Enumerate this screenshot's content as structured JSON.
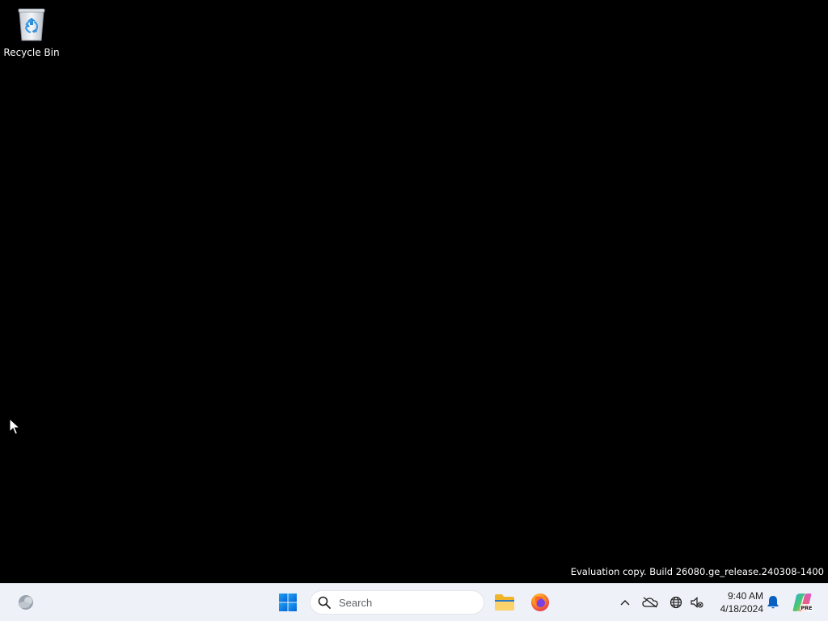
{
  "desktop": {
    "icons": [
      {
        "label": "Recycle Bin",
        "icon": "recycle-bin-icon"
      }
    ],
    "watermark": "Evaluation copy. Build 26080.ge_release.240308-1400",
    "background": "#000000"
  },
  "taskbar": {
    "background": "#eef1f7",
    "search": {
      "placeholder": "Search"
    },
    "pinned": [
      {
        "name": "File Explorer",
        "icon": "folder-icon"
      },
      {
        "name": "Firefox",
        "icon": "firefox-icon"
      }
    ],
    "tray": {
      "time": "9:40 AM",
      "date": "4/18/2024",
      "icons": [
        "chevron-up-icon",
        "onedrive-icon",
        "network-icon",
        "volume-icon",
        "bell-icon",
        "copilot-icon"
      ]
    }
  }
}
